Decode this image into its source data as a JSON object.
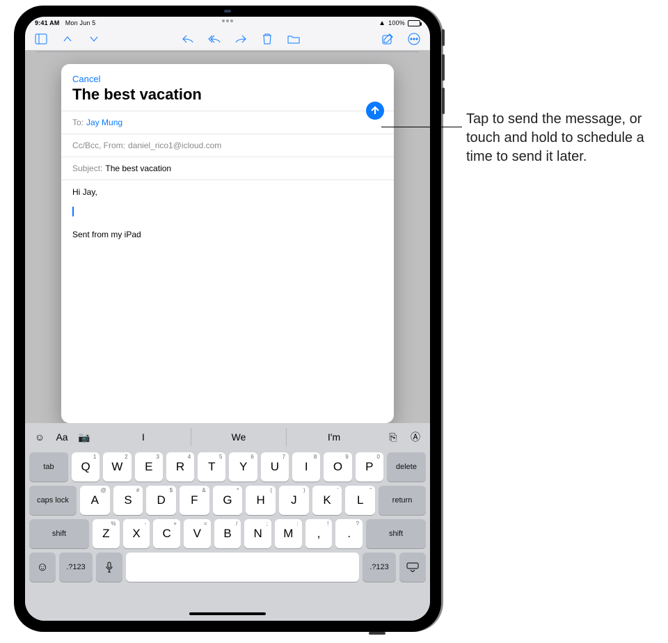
{
  "status": {
    "time": "9:41 AM",
    "date": "Mon Jun 5",
    "battery_pct": "100%"
  },
  "compose": {
    "cancel": "Cancel",
    "title": "The best vacation",
    "to_label": "To:",
    "to_value": "Jay Mung",
    "ccbcc_label": "Cc/Bcc, From:",
    "from_value": "daniel_rico1@icloud.com",
    "subject_label": "Subject:",
    "subject_value": "The best vacation",
    "body_greeting": "Hi Jay,",
    "signature": "Sent from my iPad"
  },
  "keyboard": {
    "predictions": [
      "I",
      "We",
      "I'm"
    ],
    "row1": [
      {
        "k": "Q",
        "s": "1"
      },
      {
        "k": "W",
        "s": "2"
      },
      {
        "k": "E",
        "s": "3"
      },
      {
        "k": "R",
        "s": "4"
      },
      {
        "k": "T",
        "s": "5"
      },
      {
        "k": "Y",
        "s": "6"
      },
      {
        "k": "U",
        "s": "7"
      },
      {
        "k": "I",
        "s": "8"
      },
      {
        "k": "O",
        "s": "9"
      },
      {
        "k": "P",
        "s": "0"
      }
    ],
    "row2": [
      {
        "k": "A",
        "s": "@"
      },
      {
        "k": "S",
        "s": "#"
      },
      {
        "k": "D",
        "s": "$"
      },
      {
        "k": "F",
        "s": "&"
      },
      {
        "k": "G",
        "s": "*"
      },
      {
        "k": "H",
        "s": "("
      },
      {
        "k": "J",
        "s": ")"
      },
      {
        "k": "K",
        "s": "'"
      },
      {
        "k": "L",
        "s": "\""
      }
    ],
    "row3": [
      {
        "k": "Z",
        "s": "%"
      },
      {
        "k": "X",
        "s": "-"
      },
      {
        "k": "C",
        "s": "+"
      },
      {
        "k": "V",
        "s": "="
      },
      {
        "k": "B",
        "s": "/"
      },
      {
        "k": "N",
        "s": ";"
      },
      {
        "k": "M",
        "s": ":"
      },
      {
        "k": ",",
        "s": "!"
      },
      {
        "k": ".",
        "s": "?"
      }
    ],
    "tab": "tab",
    "delete": "delete",
    "caps": "caps lock",
    "ret": "return",
    "shift": "shift",
    "num": ".?123",
    "format_label": "Aa"
  },
  "callout": {
    "text": "Tap to send the message, or touch and hold to schedule a time to send it later."
  }
}
